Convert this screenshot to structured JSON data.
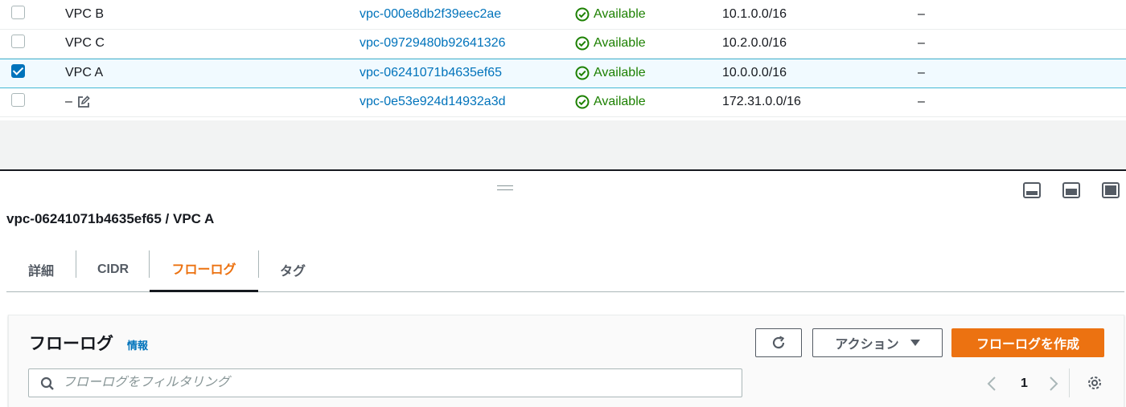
{
  "vpcs": [
    {
      "name": "VPC B",
      "id": "vpc-000e8db2f39eec2ae",
      "status": "Available",
      "cidr": "10.1.0.0/16",
      "extra": "–",
      "selected": false
    },
    {
      "name": "VPC C",
      "id": "vpc-09729480b92641326",
      "status": "Available",
      "cidr": "10.2.0.0/16",
      "extra": "–",
      "selected": false
    },
    {
      "name": "VPC A",
      "id": "vpc-06241071b4635ef65",
      "status": "Available",
      "cidr": "10.0.0.0/16",
      "extra": "–",
      "selected": true
    },
    {
      "name": "–",
      "id": "vpc-0e53e924d14932a3d",
      "status": "Available",
      "cidr": "172.31.0.0/16",
      "extra": "–",
      "selected": false
    }
  ],
  "detail": {
    "title": "vpc-06241071b4635ef65 / VPC A",
    "tabs": [
      "詳細",
      "CIDR",
      "フローログ",
      "タグ"
    ],
    "active_tab": "フローログ"
  },
  "flowlogs": {
    "title": "フローログ",
    "info": "情報",
    "action_label": "アクション",
    "create_label": "フローログを作成",
    "search_placeholder": "フローログをフィルタリング",
    "page": "1"
  },
  "colors": {
    "link": "#0073bb",
    "available": "#1d8102",
    "accent": "#ec7211",
    "selected_border": "#44b9d6"
  },
  "icons": {
    "status": "check-circle-icon",
    "edit": "edit-icon",
    "refresh": "refresh-icon",
    "search": "search-icon",
    "settings": "gear-icon"
  }
}
